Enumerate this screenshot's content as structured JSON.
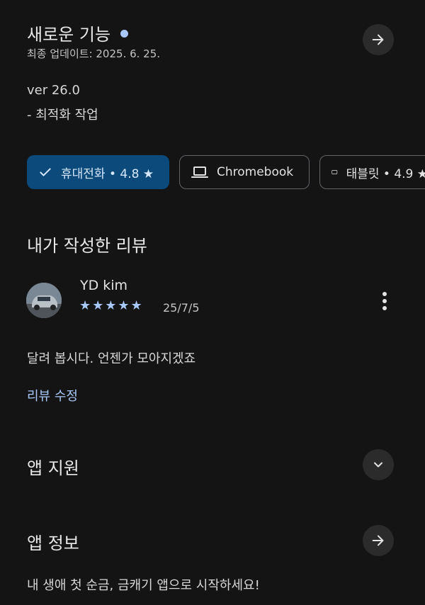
{
  "whats_new": {
    "title": "새로운 기능",
    "updated": "최종 업데이트: 2025. 6. 25.",
    "version": "ver 26.0",
    "note": "- 최적화 작업"
  },
  "device_chips": [
    {
      "label": "휴대전화 • 4.8 ★",
      "icon": "check-icon",
      "selected": true
    },
    {
      "label": "Chromebook",
      "icon": "laptop-icon",
      "selected": false
    },
    {
      "label": "태블릿 • 4.9 ★",
      "icon": "tablet-icon",
      "selected": false
    }
  ],
  "my_review": {
    "heading": "내가 작성한 리뷰",
    "author": "YD kim",
    "stars": "★★★★★",
    "rating": 5,
    "date": "25/7/5",
    "text": "달려 봅시다. 언젠가 모아지겠죠",
    "edit_label": "리뷰 수정"
  },
  "app_support": {
    "heading": "앱 지원"
  },
  "app_info": {
    "heading": "앱 정보",
    "description": "내 생애 첫 순금, 금캐기 앱으로 시작하세요!"
  },
  "colors": {
    "background": "#141414",
    "accent": "#a8c7fa",
    "chip_selected": "#0b4a7a"
  }
}
